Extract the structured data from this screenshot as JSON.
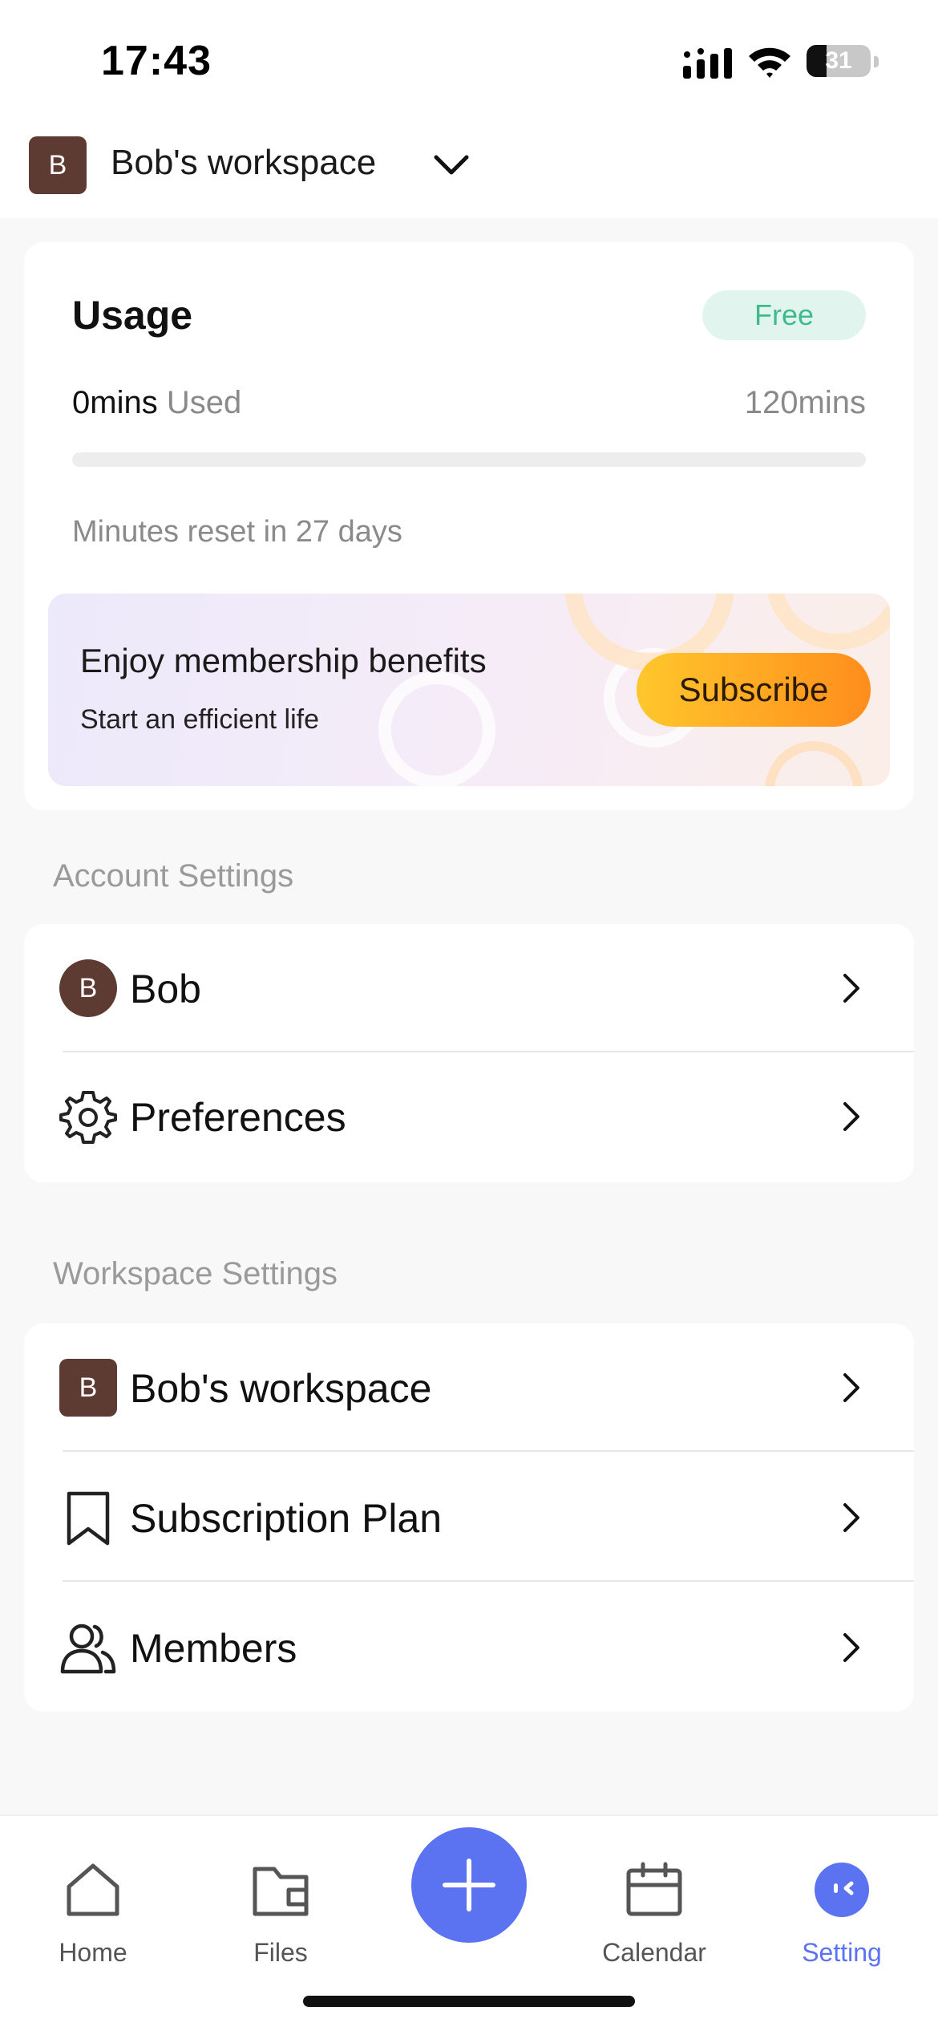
{
  "status_bar": {
    "time": "17:43",
    "battery": "31",
    "battery_level": 0.31
  },
  "header": {
    "workspace_initial": "B",
    "workspace_name": "Bob's workspace"
  },
  "usage": {
    "title": "Usage",
    "plan_badge": "Free",
    "used_value": "0mins",
    "used_label": "Used",
    "total": "120mins",
    "progress_fraction": 0,
    "reset_text": "Minutes reset in 27 days"
  },
  "promo": {
    "title": "Enjoy membership benefits",
    "subtitle": "Start an efficient life",
    "button_label": "Subscribe"
  },
  "account_settings": {
    "label": "Account Settings",
    "items": [
      {
        "label": "Bob",
        "icon": "user-avatar",
        "initial": "B"
      },
      {
        "label": "Preferences",
        "icon": "gear-icon"
      }
    ]
  },
  "workspace_settings": {
    "label": "Workspace Settings",
    "items": [
      {
        "label": "Bob's workspace",
        "icon": "workspace-avatar",
        "initial": "B"
      },
      {
        "label": "Subscription Plan",
        "icon": "bookmark-icon"
      },
      {
        "label": "Members",
        "icon": "users-icon"
      }
    ]
  },
  "bottom_nav": {
    "items": [
      {
        "label": "Home",
        "icon": "home-icon"
      },
      {
        "label": "Files",
        "icon": "folder-icon"
      },
      {
        "label": "Calendar",
        "icon": "calendar-icon"
      },
      {
        "label": "Setting",
        "icon": "setting-face-icon",
        "active": true
      }
    ],
    "fab_icon": "plus-icon"
  },
  "colors": {
    "accent": "#5b73f0",
    "avatar_bg": "#5d3a32",
    "badge_bg": "#e1f5ee",
    "badge_text": "#3fba8e",
    "subscribe_gradient_start": "#ffc72c",
    "subscribe_gradient_end": "#ff8d1c"
  }
}
